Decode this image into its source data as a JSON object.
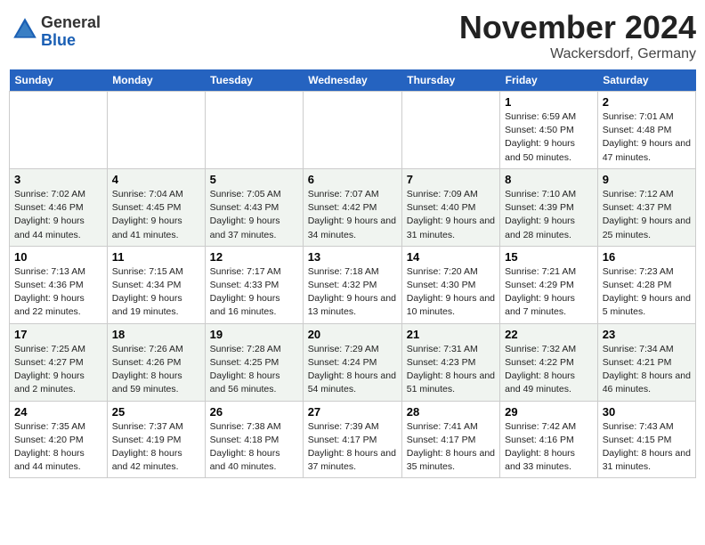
{
  "logo": {
    "general": "General",
    "blue": "Blue"
  },
  "header": {
    "month": "November 2024",
    "location": "Wackersdorf, Germany"
  },
  "columns": [
    "Sunday",
    "Monday",
    "Tuesday",
    "Wednesday",
    "Thursday",
    "Friday",
    "Saturday"
  ],
  "weeks": [
    {
      "days": [
        {
          "num": "",
          "info": ""
        },
        {
          "num": "",
          "info": ""
        },
        {
          "num": "",
          "info": ""
        },
        {
          "num": "",
          "info": ""
        },
        {
          "num": "",
          "info": ""
        },
        {
          "num": "1",
          "info": "Sunrise: 6:59 AM\nSunset: 4:50 PM\nDaylight: 9 hours and 50 minutes."
        },
        {
          "num": "2",
          "info": "Sunrise: 7:01 AM\nSunset: 4:48 PM\nDaylight: 9 hours and 47 minutes."
        }
      ]
    },
    {
      "days": [
        {
          "num": "3",
          "info": "Sunrise: 7:02 AM\nSunset: 4:46 PM\nDaylight: 9 hours and 44 minutes."
        },
        {
          "num": "4",
          "info": "Sunrise: 7:04 AM\nSunset: 4:45 PM\nDaylight: 9 hours and 41 minutes."
        },
        {
          "num": "5",
          "info": "Sunrise: 7:05 AM\nSunset: 4:43 PM\nDaylight: 9 hours and 37 minutes."
        },
        {
          "num": "6",
          "info": "Sunrise: 7:07 AM\nSunset: 4:42 PM\nDaylight: 9 hours and 34 minutes."
        },
        {
          "num": "7",
          "info": "Sunrise: 7:09 AM\nSunset: 4:40 PM\nDaylight: 9 hours and 31 minutes."
        },
        {
          "num": "8",
          "info": "Sunrise: 7:10 AM\nSunset: 4:39 PM\nDaylight: 9 hours and 28 minutes."
        },
        {
          "num": "9",
          "info": "Sunrise: 7:12 AM\nSunset: 4:37 PM\nDaylight: 9 hours and 25 minutes."
        }
      ]
    },
    {
      "days": [
        {
          "num": "10",
          "info": "Sunrise: 7:13 AM\nSunset: 4:36 PM\nDaylight: 9 hours and 22 minutes."
        },
        {
          "num": "11",
          "info": "Sunrise: 7:15 AM\nSunset: 4:34 PM\nDaylight: 9 hours and 19 minutes."
        },
        {
          "num": "12",
          "info": "Sunrise: 7:17 AM\nSunset: 4:33 PM\nDaylight: 9 hours and 16 minutes."
        },
        {
          "num": "13",
          "info": "Sunrise: 7:18 AM\nSunset: 4:32 PM\nDaylight: 9 hours and 13 minutes."
        },
        {
          "num": "14",
          "info": "Sunrise: 7:20 AM\nSunset: 4:30 PM\nDaylight: 9 hours and 10 minutes."
        },
        {
          "num": "15",
          "info": "Sunrise: 7:21 AM\nSunset: 4:29 PM\nDaylight: 9 hours and 7 minutes."
        },
        {
          "num": "16",
          "info": "Sunrise: 7:23 AM\nSunset: 4:28 PM\nDaylight: 9 hours and 5 minutes."
        }
      ]
    },
    {
      "days": [
        {
          "num": "17",
          "info": "Sunrise: 7:25 AM\nSunset: 4:27 PM\nDaylight: 9 hours and 2 minutes."
        },
        {
          "num": "18",
          "info": "Sunrise: 7:26 AM\nSunset: 4:26 PM\nDaylight: 8 hours and 59 minutes."
        },
        {
          "num": "19",
          "info": "Sunrise: 7:28 AM\nSunset: 4:25 PM\nDaylight: 8 hours and 56 minutes."
        },
        {
          "num": "20",
          "info": "Sunrise: 7:29 AM\nSunset: 4:24 PM\nDaylight: 8 hours and 54 minutes."
        },
        {
          "num": "21",
          "info": "Sunrise: 7:31 AM\nSunset: 4:23 PM\nDaylight: 8 hours and 51 minutes."
        },
        {
          "num": "22",
          "info": "Sunrise: 7:32 AM\nSunset: 4:22 PM\nDaylight: 8 hours and 49 minutes."
        },
        {
          "num": "23",
          "info": "Sunrise: 7:34 AM\nSunset: 4:21 PM\nDaylight: 8 hours and 46 minutes."
        }
      ]
    },
    {
      "days": [
        {
          "num": "24",
          "info": "Sunrise: 7:35 AM\nSunset: 4:20 PM\nDaylight: 8 hours and 44 minutes."
        },
        {
          "num": "25",
          "info": "Sunrise: 7:37 AM\nSunset: 4:19 PM\nDaylight: 8 hours and 42 minutes."
        },
        {
          "num": "26",
          "info": "Sunrise: 7:38 AM\nSunset: 4:18 PM\nDaylight: 8 hours and 40 minutes."
        },
        {
          "num": "27",
          "info": "Sunrise: 7:39 AM\nSunset: 4:17 PM\nDaylight: 8 hours and 37 minutes."
        },
        {
          "num": "28",
          "info": "Sunrise: 7:41 AM\nSunset: 4:17 PM\nDaylight: 8 hours and 35 minutes."
        },
        {
          "num": "29",
          "info": "Sunrise: 7:42 AM\nSunset: 4:16 PM\nDaylight: 8 hours and 33 minutes."
        },
        {
          "num": "30",
          "info": "Sunrise: 7:43 AM\nSunset: 4:15 PM\nDaylight: 8 hours and 31 minutes."
        }
      ]
    }
  ]
}
